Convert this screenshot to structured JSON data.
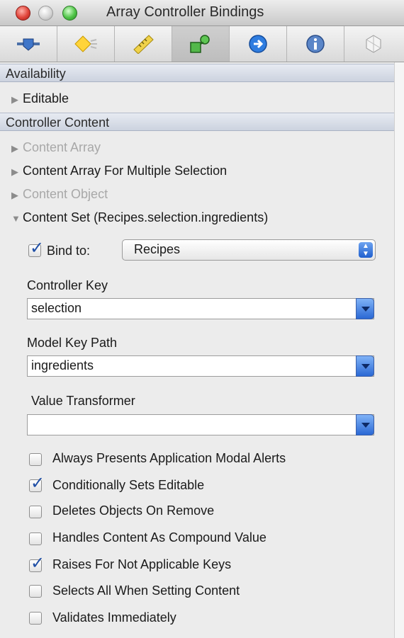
{
  "window": {
    "title": "Array Controller Bindings"
  },
  "toolbar": {
    "icons": [
      "attributes-icon",
      "effects-icon",
      "size-icon",
      "bindings-icon",
      "connections-icon",
      "identity-icon",
      "extra-icon"
    ],
    "active_index": 3
  },
  "sections": {
    "availability": "Availability",
    "controller_content": "Controller Content"
  },
  "bindings": {
    "editable": "Editable",
    "content_array": "Content Array",
    "content_array_multi": "Content Array For Multiple Selection",
    "content_object": "Content Object",
    "content_set": "Content Set (Recipes.selection.ingredients)"
  },
  "bind_to": {
    "label": "Bind to:",
    "value": "Recipes",
    "checked": true
  },
  "controller_key": {
    "label": "Controller Key",
    "value": "selection"
  },
  "model_key_path": {
    "label": "Model Key Path",
    "value": "ingredients"
  },
  "value_transformer": {
    "label": "Value Transformer",
    "value": ""
  },
  "options": [
    {
      "label": "Always Presents Application Modal Alerts",
      "checked": false
    },
    {
      "label": "Conditionally Sets Editable",
      "checked": true
    },
    {
      "label": "Deletes Objects On Remove",
      "checked": false
    },
    {
      "label": "Handles Content As Compound Value",
      "checked": false
    },
    {
      "label": "Raises For Not Applicable Keys",
      "checked": true
    },
    {
      "label": "Selects All When Setting Content",
      "checked": false
    },
    {
      "label": "Validates Immediately",
      "checked": false
    }
  ]
}
